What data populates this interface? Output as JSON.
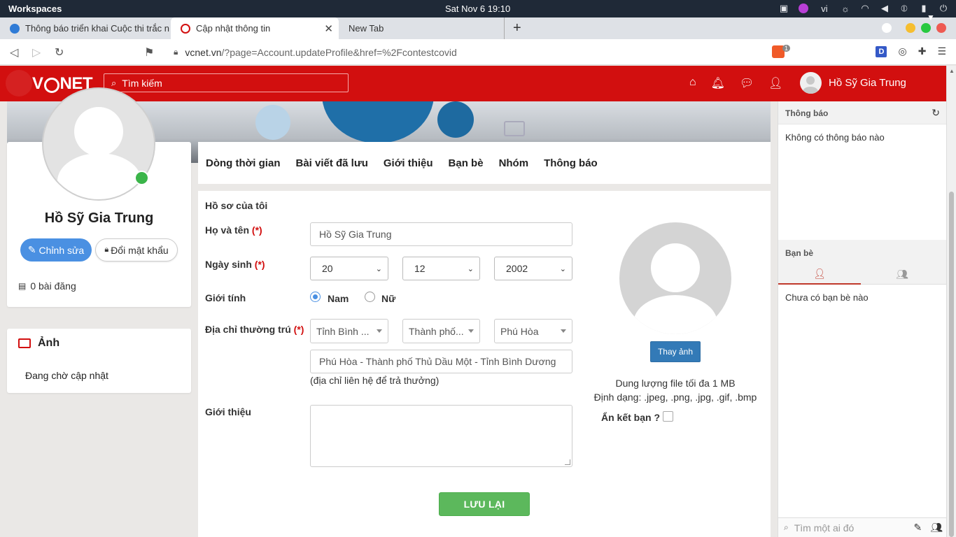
{
  "os": {
    "workspaces": "Workspaces",
    "clock": "Sat Nov 6  19:10",
    "lang": "vi"
  },
  "browser": {
    "tabs": [
      {
        "label": "Thông báo triển khai Cuộc thi trắc n"
      },
      {
        "label": "Cập nhật thông tin"
      },
      {
        "label": "New Tab"
      }
    ],
    "url_host": "vcnet.vn",
    "url_path": "/?page=Account.updateProfile&href=%2Fcontestcovid",
    "brave_count": "1"
  },
  "site": {
    "logo_text_v": "V",
    "logo_text_net": "NET",
    "search_placeholder": "Tìm kiếm",
    "user_name": "Hồ Sỹ Gia Trung"
  },
  "profile": {
    "name": "Hồ Sỹ Gia Trung",
    "edit_label": "Chỉnh sửa",
    "password_label": "Đổi mật khẩu",
    "posts": "0 bài đăng",
    "photos_title": "Ảnh",
    "photos_status": "Đang chờ cập nhật"
  },
  "profile_tabs": [
    "Dòng thời gian",
    "Bài viết đã lưu",
    "Giới thiệu",
    "Bạn bè",
    "Nhóm",
    "Thông báo"
  ],
  "form": {
    "title": "Hồ sơ của tôi",
    "fullname_label": "Họ và tên",
    "required_mark": "(*)",
    "fullname_value": "Hồ Sỹ Gia Trung",
    "dob_label": "Ngày sinh",
    "dob_day": "20",
    "dob_month": "12",
    "dob_year": "2002",
    "gender_label": "Giới tính",
    "gender_male": "Nam",
    "gender_female": "Nữ",
    "gender_selected": "Nam",
    "address_label": "Địa chỉ thường trú",
    "province": "Tỉnh Bình ...",
    "city": "Thành phố...",
    "ward": "Phú Hòa",
    "address_full": "Phú Hòa - Thành phố Thủ Dầu Một - Tỉnh Bình Dương",
    "address_hint": "(địa chỉ liên hệ để trả thưởng)",
    "intro_label": "Giới thiệu",
    "intro_value": "",
    "save_label": "LƯU LẠI",
    "change_photo": "Thay ảnh",
    "file_size": "Dung lượng file tối đa 1 MB",
    "file_formats": "Định dạng: .jpeg, .png, .jpg, .gif, .bmp",
    "hide_friends": "Ẩn kết bạn ?",
    "hide_friends_checked": false
  },
  "sidebar": {
    "notif_title": "Thông báo",
    "notif_empty": "Không có thông báo nào",
    "friends_title": "Bạn bè",
    "friends_empty": "Chưa có bạn bè nào",
    "search_placeholder": "Tìm một ai đó"
  },
  "colors": {
    "brand_red": "#d20f0f",
    "primary_blue": "#4a90e2",
    "save_green": "#5cb85c"
  }
}
